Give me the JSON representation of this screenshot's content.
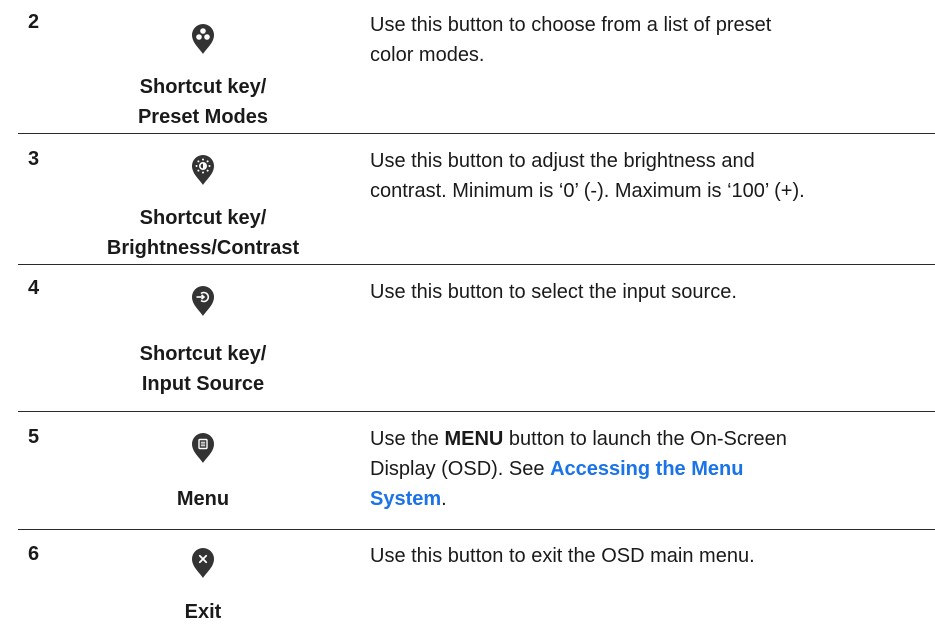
{
  "rows": [
    {
      "number": "2",
      "icon": "preset-modes-icon",
      "label_line1": "Shortcut key/",
      "label_line2": "Preset Modes",
      "desc_line1": "Use this button to choose from a list of preset",
      "desc_line2": "color modes."
    },
    {
      "number": "3",
      "icon": "brightness-contrast-icon",
      "label_line1": "Shortcut key/",
      "label_line2": "Brightness/Contrast",
      "desc_line1": "Use this button to adjust the brightness and",
      "desc_line2": "contrast. Minimum is ‘0’ (-). Maximum is ‘100’ (+)."
    },
    {
      "number": "4",
      "icon": "input-source-icon",
      "label_line1": "Shortcut key/",
      "label_line2": "Input Source",
      "desc_line1": "Use this button to select the input source."
    },
    {
      "number": "5",
      "icon": "menu-icon",
      "label_line1": "Menu",
      "desc_pre": "Use the ",
      "desc_bold": "MENU",
      "desc_post": " button to launch the On-Screen",
      "desc_line2_pre": "Display (OSD). See ",
      "link_line1": "Accessing the Menu",
      "link_line2": "System",
      "desc_end": "."
    },
    {
      "number": "6",
      "icon": "exit-icon",
      "label_line1": "Exit",
      "desc_line1": "Use this button to exit the OSD main menu."
    }
  ],
  "colors": {
    "icon_fill": "#333333",
    "link": "#1a73e8",
    "rule": "#2a2a2a"
  }
}
